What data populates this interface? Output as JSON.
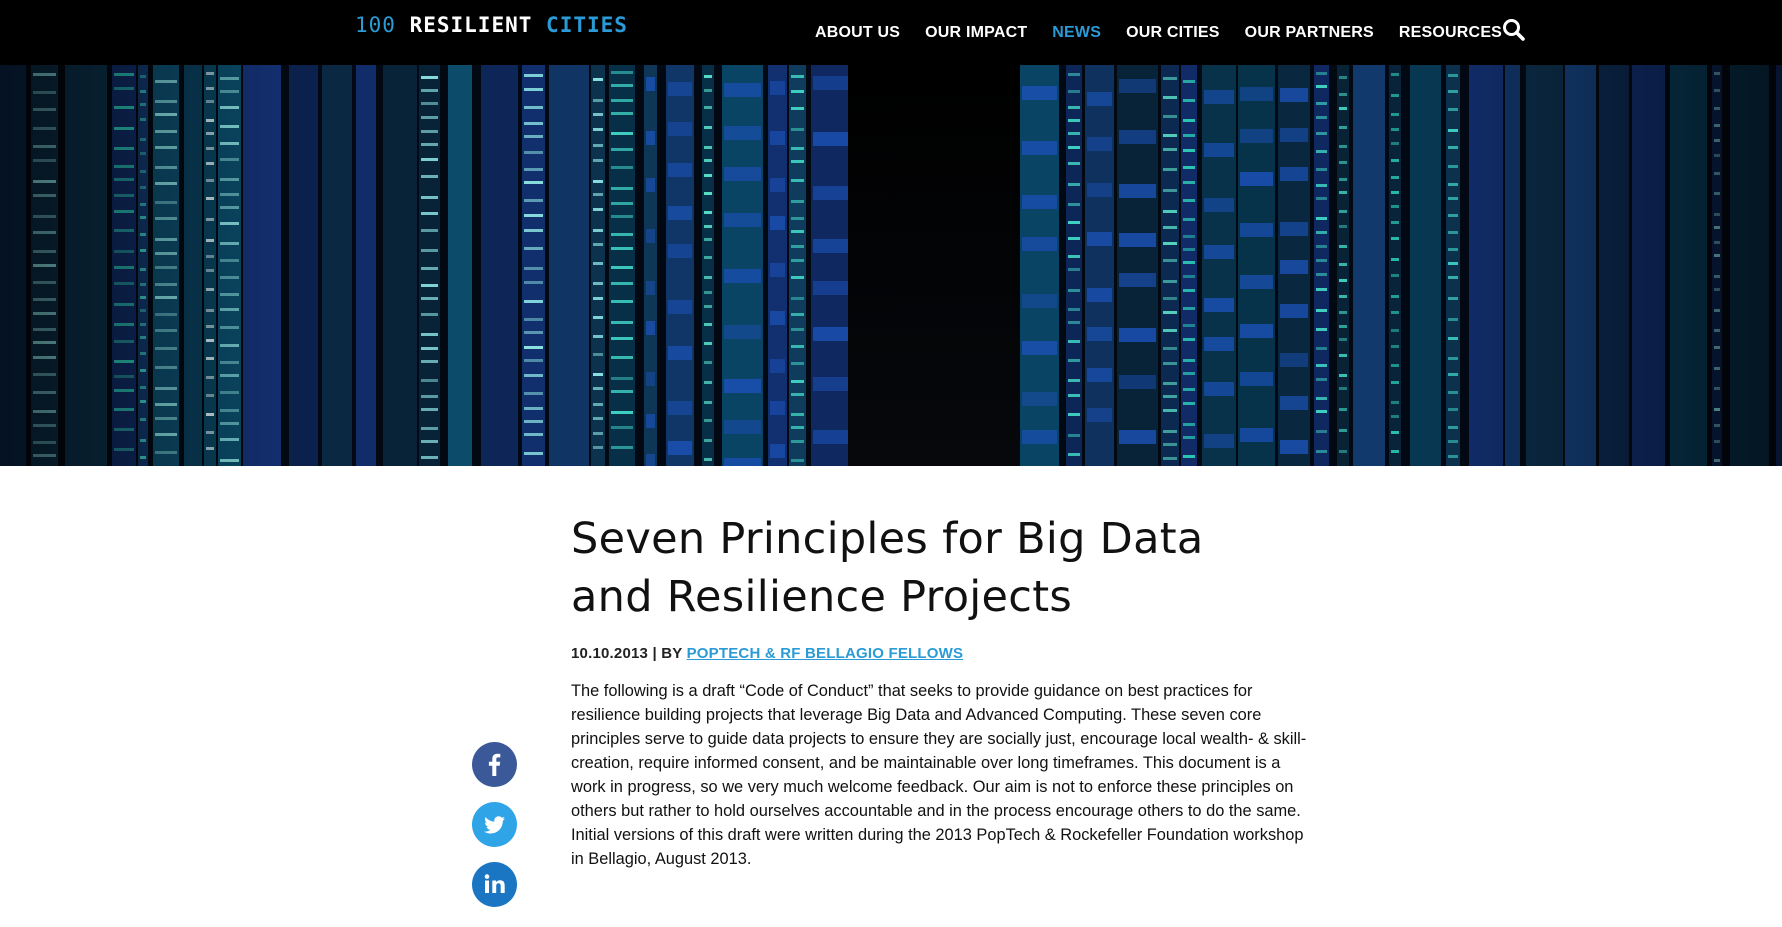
{
  "brand": {
    "logo_num": "100",
    "logo_mid": "RESILIENT",
    "logo_end": "CITIES"
  },
  "nav": {
    "items": [
      {
        "label": "ABOUT US",
        "active": false
      },
      {
        "label": "OUR IMPACT",
        "active": false
      },
      {
        "label": "NEWS",
        "active": true
      },
      {
        "label": "OUR CITIES",
        "active": false
      },
      {
        "label": "OUR PARTNERS",
        "active": false
      },
      {
        "label": "RESOURCES",
        "active": false
      }
    ],
    "search_icon": "search-icon"
  },
  "hero": {
    "image": "server-racks-data-center"
  },
  "article": {
    "title_line1": "Seven Principles for Big Data",
    "title_line2": "and Resilience Projects",
    "date": "10.10.2013",
    "by": "| BY",
    "author": "POPTECH & RF BELLAGIO FELLOWS",
    "body": "The following is a draft “Code of Conduct” that seeks to provide guidance on best practices for resilience building projects that leverage Big Data and Advanced Computing. These seven core principles serve to guide data projects to ensure they are socially just, encourage local wealth- & skill-creation, require informed consent, and be maintainable over long timeframes. This document is a work in progress, so we very much welcome feedback. Our aim is not to enforce these principles on others but rather to hold ourselves accountable and in the process encourage others to do the same. Initial versions of this draft were written during the 2013 PopTech & Rockefeller Foundation workshop in Bellagio, August 2013."
  },
  "share": {
    "items": [
      {
        "network": "facebook",
        "icon": "facebook-icon"
      },
      {
        "network": "twitter",
        "icon": "twitter-icon"
      },
      {
        "network": "linkedin",
        "icon": "linkedin-icon"
      }
    ]
  },
  "colors": {
    "accent": "#2a9bd6",
    "nav_bg": "#000000",
    "facebook": "#3b5998",
    "twitter": "#2fa4e7",
    "linkedin": "#1a75c2"
  }
}
